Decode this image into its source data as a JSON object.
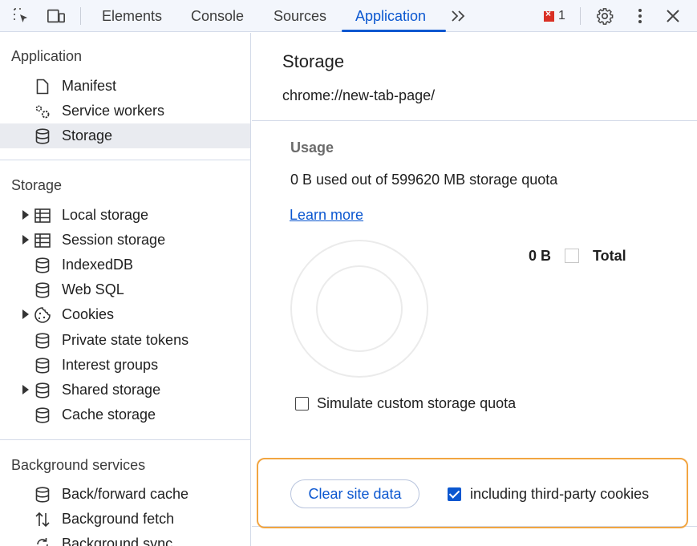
{
  "toolbar": {
    "tabs": [
      "Elements",
      "Console",
      "Sources",
      "Application"
    ],
    "active_tab": "Application",
    "more_tabs_icon": "double-chevron-right-icon",
    "error_count": "1",
    "accent": "#0b57d0"
  },
  "sidebar": {
    "application": {
      "title": "Application",
      "items": [
        "Manifest",
        "Service workers",
        "Storage"
      ]
    },
    "storage": {
      "title": "Storage",
      "items": [
        "Local storage",
        "Session storage",
        "IndexedDB",
        "Web SQL",
        "Cookies",
        "Private state tokens",
        "Interest groups",
        "Shared storage",
        "Cache storage"
      ]
    },
    "background": {
      "title": "Background services",
      "items": [
        "Back/forward cache",
        "Background fetch",
        "Background sync"
      ]
    }
  },
  "main": {
    "title": "Storage",
    "origin": "chrome://new-tab-page/",
    "usage_heading": "Usage",
    "usage_text": "0 B used out of 599620 MB storage quota",
    "learn_more": "Learn more",
    "legend_value": "0 B",
    "legend_label": "Total",
    "simulate_label": "Simulate custom storage quota",
    "simulate_checked": false,
    "clear_button": "Clear site data",
    "include_cookies_label": "including third-party cookies",
    "include_cookies_checked": true,
    "highlight_color": "#f2a541"
  }
}
